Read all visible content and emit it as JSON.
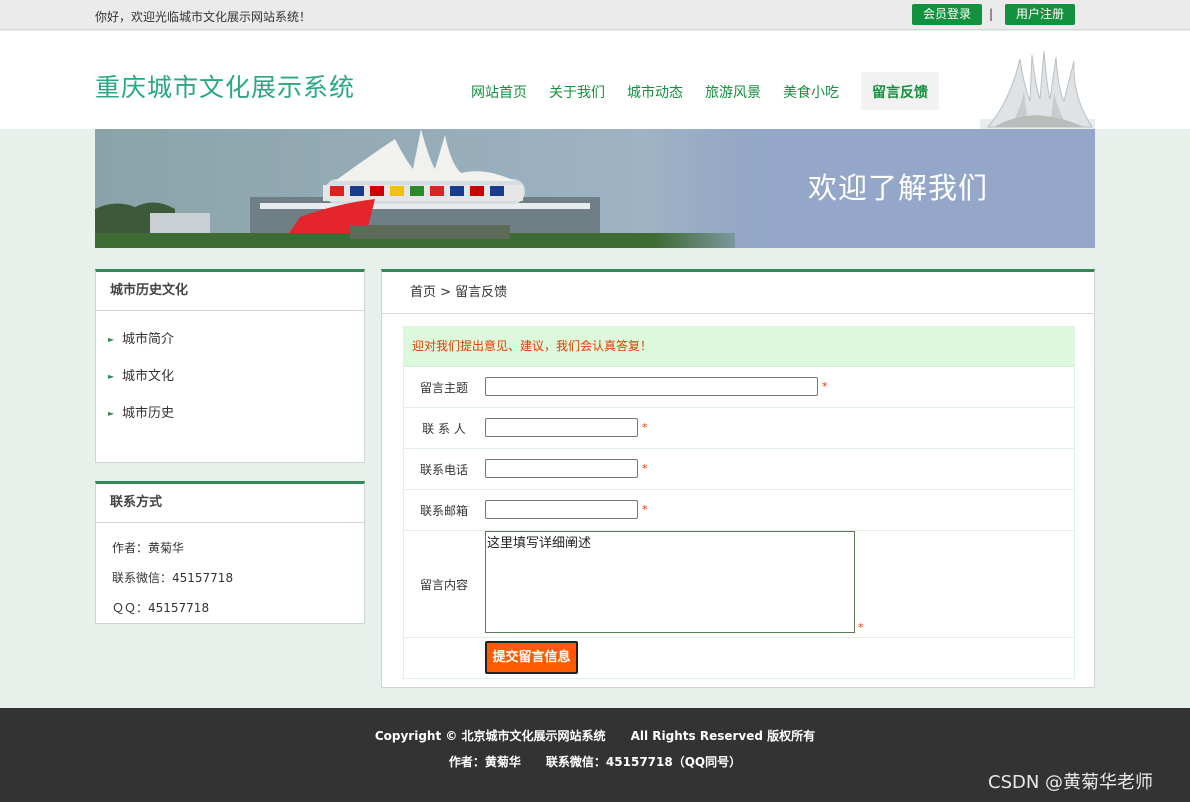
{
  "topbar": {
    "welcome": "你好，欢迎光临城市文化展示网站系统！",
    "login": "会员登录",
    "separator": "|",
    "register": "用户注册"
  },
  "header": {
    "title": "重庆城市文化展示系统",
    "nav": [
      "网站首页",
      "关于我们",
      "城市动态",
      "旅游风景",
      "美食小吃",
      "留言反馈"
    ],
    "active_nav": "留言反馈"
  },
  "banner": {
    "text": "欢迎了解我们"
  },
  "sidebar": {
    "history": {
      "title": "城市历史文化",
      "items": [
        "城市简介",
        "城市文化",
        "城市历史"
      ]
    },
    "contact": {
      "title": "联系方式",
      "lines": [
        "作者：黄菊华",
        "联系微信：45157718",
        "ＱＱ：45157718"
      ]
    }
  },
  "main": {
    "breadcrumb": "首页 > 留言反馈",
    "notice": "迎对我们提出意见、建议，我们会认真答复！",
    "form": {
      "subject_label": "留言主题",
      "contact_label": "联 系 人",
      "phone_label": "联系电话",
      "email_label": "联系邮箱",
      "content_label": "留言内容",
      "content_value": "这里填写详细阐述",
      "required_mark": "*",
      "submit_label": "提交留言信息"
    }
  },
  "footer": {
    "line1": "Copyright © 北京城市文化展示网站系统      All Rights Reserved 版权所有",
    "line2": "作者：黄菊华      联系微信：45157718（QQ同号）",
    "watermark": "CSDN @黄菊华老师"
  },
  "colors": {
    "brand_green": "#13913f",
    "title_teal": "#2aa884",
    "accent_orange": "#ff5a00",
    "notice_bg": "#ddf9db",
    "footer_bg": "#333333"
  }
}
